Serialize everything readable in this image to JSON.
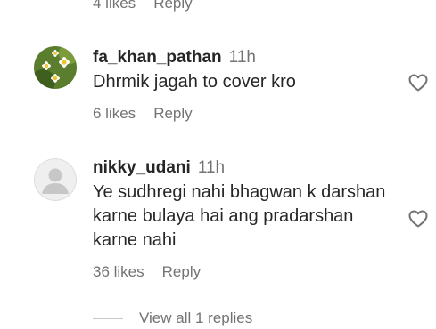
{
  "previous_comment": {
    "likes": "4 likes",
    "reply": "Reply"
  },
  "comments": [
    {
      "username": "fa_khan_pathan",
      "time": "11h",
      "text": "Dhrmik jagah to cover kro",
      "likes": "6 likes",
      "reply": "Reply",
      "avatar": "daisy-flowers-avatar",
      "liked": false
    },
    {
      "username": "nikky_udani",
      "time": "11h",
      "text": "Ye sudhregi nahi bhagwan k darshan karne bulaya hai ang pradarshan karne nahi",
      "likes": "36 likes",
      "reply": "Reply",
      "avatar": "default-user-avatar",
      "liked": false
    }
  ],
  "view_replies": "View all 1 replies",
  "colors": {
    "text": "#262626",
    "secondary": "#737373",
    "divider": "#c7c7c7",
    "background": "#ffffff"
  }
}
